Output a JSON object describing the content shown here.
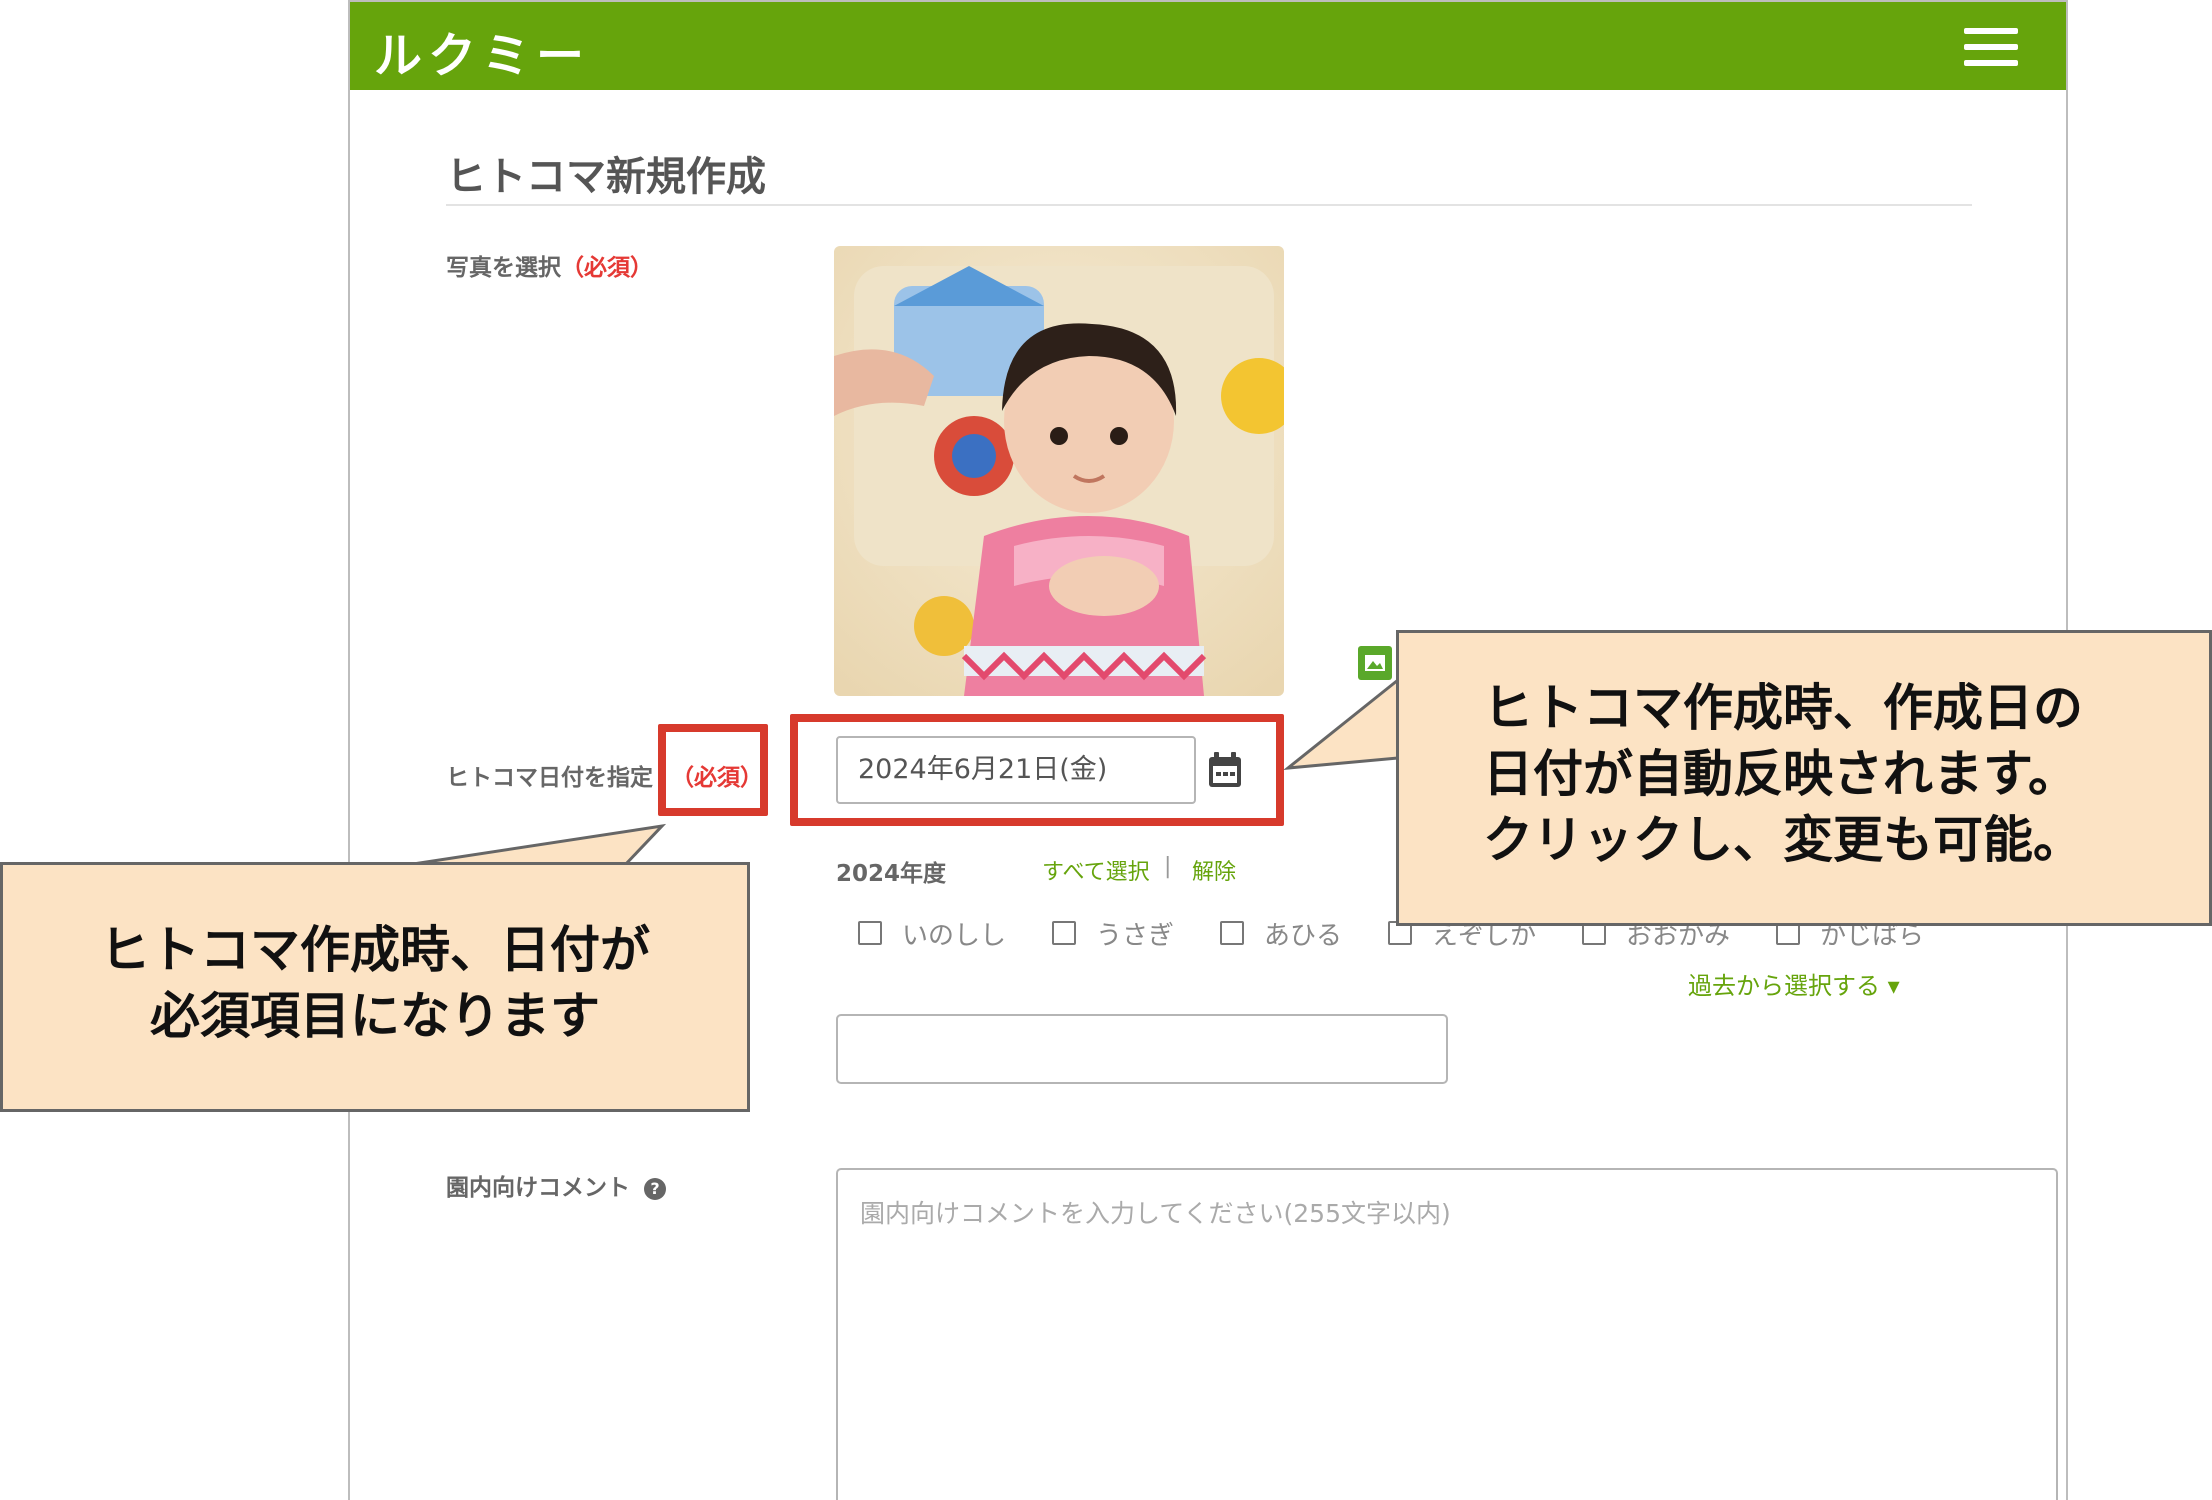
{
  "header": {
    "logo": "ルクミー",
    "menu_icon": "hamburger-menu-icon",
    "brand_color": "#66a40c"
  },
  "page": {
    "title": "ヒトコマ新規作成"
  },
  "photo_field": {
    "label": "写真を選択",
    "required": "（必須）",
    "image_icon": "image-icon"
  },
  "date_field": {
    "label": "ヒトコマ日付を指定",
    "required": "（必須）",
    "value": "2024年6月21日(金)",
    "calendar_icon": "calendar-icon"
  },
  "class_field": {
    "year_label": "2024年度",
    "select_all": "すべて選択",
    "separator": "|",
    "clear": "解除",
    "classes": [
      "いのしし",
      "うさぎ",
      "あひる",
      "えぞしか",
      "おおかみ",
      "かじばら"
    ],
    "past_select": "過去から選択する ▾"
  },
  "comment_field": {
    "label": "園内向けコメント",
    "help_icon": "?",
    "placeholder": "園内向けコメントを入力してください(255文字以内)"
  },
  "callouts": {
    "right": [
      "ヒトコマ作成時、作成日の",
      "日付が自動反映されます。",
      "クリックし、変更も可能。"
    ],
    "left": [
      "ヒトコマ作成時、日付が",
      "必須項目になります"
    ]
  },
  "colors": {
    "highlight": "#d73a2c",
    "callout_bg": "#fce3c4",
    "required": "#e53935"
  }
}
